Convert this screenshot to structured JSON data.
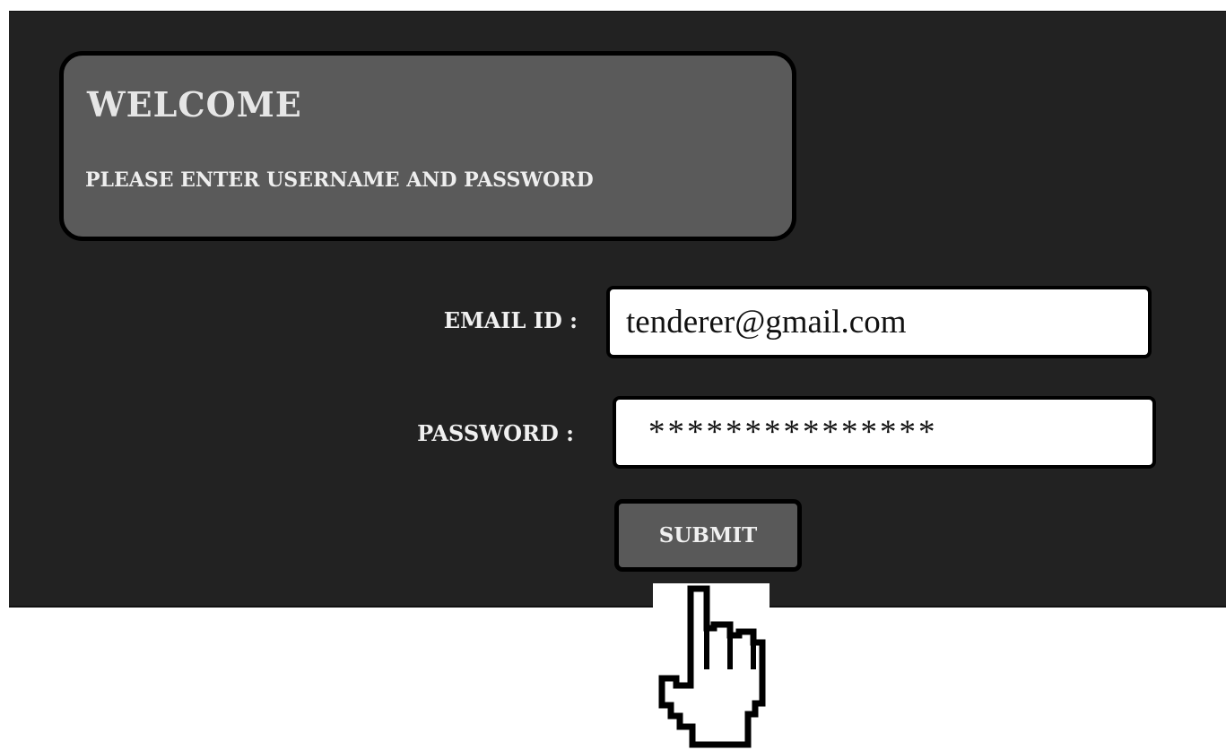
{
  "header": {
    "title": "WELCOME",
    "subtitle": "PLEASE ENTER USERNAME AND PASSWORD"
  },
  "form": {
    "email_label": "EMAIL ID :",
    "email_value": "tenderer@gmail.com",
    "password_label": "PASSWORD :",
    "password_value": "***************",
    "submit_label": "SUBMIT"
  },
  "cursor": {
    "icon": "hand-pointer-icon"
  },
  "colors": {
    "panel_background": "#222222",
    "welcome_box": "#5a5a5a",
    "submit_button": "#595959",
    "input_background": "#ffffff",
    "text_light": "#f0f0f0"
  }
}
